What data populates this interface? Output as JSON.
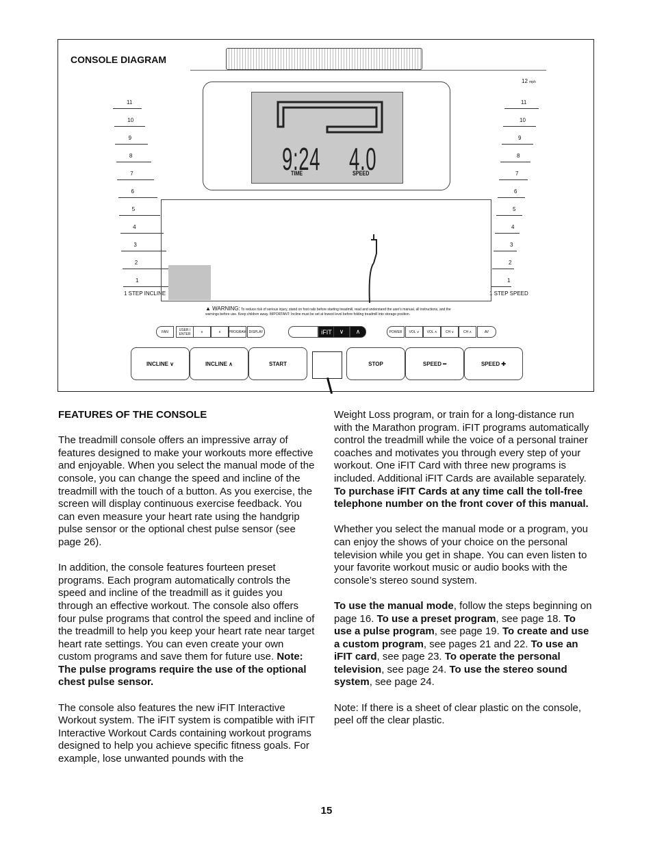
{
  "diagram": {
    "title": "CONSOLE DIAGRAM",
    "incline_ticks": [
      "11",
      "10",
      "9",
      "8",
      "7",
      "6",
      "5",
      "4",
      "3",
      "2",
      "1"
    ],
    "incline_label": "1 STEP INCLINE",
    "speed_unit_top": "12",
    "speed_unit": "mph",
    "speed_ticks": [
      "11",
      "10",
      "9",
      "8",
      "7",
      "6",
      "5",
      "4",
      "3",
      "2",
      "1"
    ],
    "speed_label": "1 STEP SPEED",
    "display": {
      "time_value": "9:24",
      "time_label": "TIME",
      "speed_value": "4.0",
      "speed_label": "SPEED"
    },
    "warning_title": "▲ WARNING:",
    "warning_text": "To reduce risk of serious injury, stand on foot rails before starting treadmill, read and understand the user's manual, all instructions, and the warnings before use. Keep children away. IMPORTANT: Incline must be set at lowest level before folding treadmill into storage position.",
    "small_buttons_left": [
      "FAN",
      "USER / ENTER",
      "∨",
      "∧",
      "PROGRAM",
      "DISPLAY"
    ],
    "ifit_buttons": [
      "iFIT",
      "∨",
      "∧"
    ],
    "small_buttons_right": [
      "POWER",
      "VOL ∨",
      "VOL ∧",
      "CH ∨",
      "CH ∧",
      "AV"
    ],
    "big_buttons": [
      "INCLINE ∨",
      "INCLINE ∧",
      "START",
      "STOP",
      "SPEED ━",
      "SPEED ✚"
    ]
  },
  "heading": "FEATURES OF THE CONSOLE",
  "left_paragraphs": [
    [
      {
        "t": "The treadmill console offers an impressive array of features designed to make your workouts more effective and enjoyable. When you select the manual mode of the console, you can change the speed and incline of the treadmill with the touch of a button. As you exercise, the screen will display continuous exercise feedback. You can even measure your heart rate using the handgrip pulse sensor or the optional chest pulse sensor (see page 26)."
      }
    ],
    [
      {
        "t": "In addition, the console features fourteen preset programs. Each program automatically controls the speed and incline of the treadmill as it guides you through an effective workout. The console also offers four pulse programs that control the speed and incline of the treadmill to help you keep your heart rate near target heart rate settings. You can even create your own custom programs and save them for future use. "
      },
      {
        "t": "Note: The pulse programs require the use of the optional chest pulse sensor.",
        "b": true
      }
    ],
    [
      {
        "t": "The console also features the new iFIT Interactive Workout system. The iFIT system is compatible with iFIT Interactive Workout Cards containing workout programs designed to help you achieve specific fitness goals. For example, lose unwanted pounds with the"
      }
    ]
  ],
  "right_paragraphs": [
    [
      {
        "t": "Weight Loss program, or train for a long-distance run with the Marathon program. iFIT programs automatically control the treadmill while the voice of a personal trainer coaches and motivates you through every step of your workout. One iFIT Card with three new programs is included. Additional iFIT Cards are available separately. "
      },
      {
        "t": "To purchase iFIT Cards at any time call the toll-free telephone number on the front cover of this manual.",
        "b": true
      }
    ],
    [
      {
        "t": "Whether you select the manual mode or a program, you can enjoy the shows of your choice on the personal television while you get in shape. You can even listen to your favorite workout music or audio books with the console’s stereo sound system."
      }
    ],
    [
      {
        "t": "To use the manual mode",
        "b": true
      },
      {
        "t": ", follow the steps beginning on page 16. "
      },
      {
        "t": "To use a preset program",
        "b": true
      },
      {
        "t": ", see page 18. "
      },
      {
        "t": "To use a pulse program",
        "b": true
      },
      {
        "t": ", see page 19. "
      },
      {
        "t": "To create and use a custom program",
        "b": true
      },
      {
        "t": ", see pages 21 and 22. "
      },
      {
        "t": "To use an iFIT card",
        "b": true
      },
      {
        "t": ", see page 23. "
      },
      {
        "t": "To operate the personal television",
        "b": true
      },
      {
        "t": ", see page 24. "
      },
      {
        "t": "To use the stereo sound system",
        "b": true
      },
      {
        "t": ", see page 24."
      }
    ],
    [
      {
        "t": "Note: If there is a sheet of clear plastic on the console, peel off the clear plastic."
      }
    ]
  ],
  "page_number": "15"
}
